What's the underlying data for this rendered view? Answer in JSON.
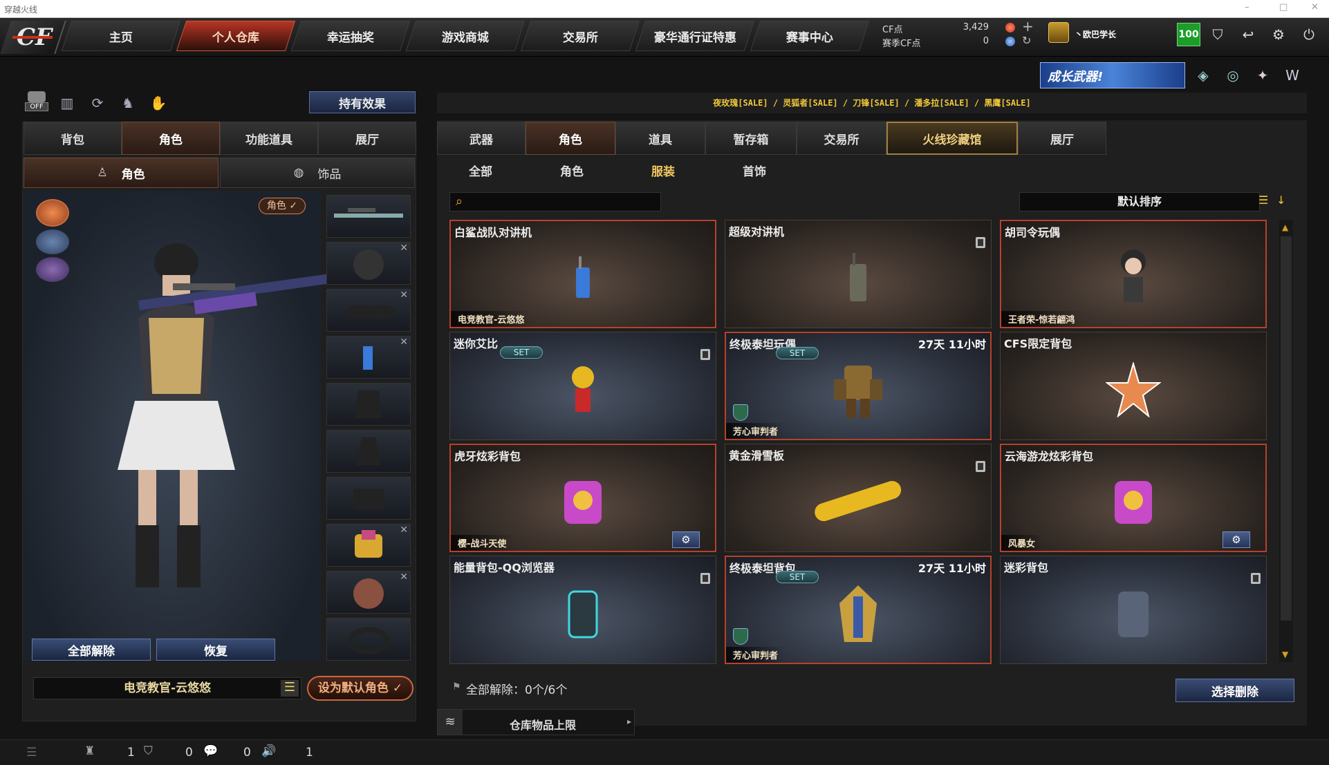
{
  "window": {
    "title": "穿越火线",
    "controls": [
      "–",
      "□",
      "✕"
    ]
  },
  "nav": {
    "items": [
      "主页",
      "个人仓库",
      "幸运抽奖",
      "游戏商城",
      "交易所",
      "豪华通行证特惠",
      "赛事中心"
    ],
    "active": 1
  },
  "currency": {
    "cf_label": "CF点",
    "cf_value": "3,429",
    "match_label": "赛季CF点",
    "match_value": "0"
  },
  "user": {
    "name": "丶欧巴学长",
    "level": "100"
  },
  "promo": {
    "banner": "成长武器!",
    "sales": "夜玫瑰[SALE] / 灵狐者[SALE] / 刀锋[SALE] / 潘多拉[SALE] / 黑鹰[SALE]"
  },
  "left": {
    "effects_btn": "持有效果",
    "tabs": [
      "背包",
      "角色",
      "功能道具",
      "展厅"
    ],
    "active_tab": 1,
    "subtabs": [
      "角色",
      "饰品"
    ],
    "role_badge": "角色 ✓",
    "unequip_all": "全部解除",
    "restore": "恢复",
    "character_name": "电竞教官-云悠悠",
    "set_default": "设为默认角色 ✓",
    "off_label": "OFF"
  },
  "right": {
    "tabs": [
      "武器",
      "角色",
      "道具",
      "暂存箱",
      "交易所",
      "火线珍藏馆",
      "展厅"
    ],
    "active_tab": 1,
    "subtabs": [
      "全部",
      "角色",
      "服装",
      "首饰"
    ],
    "active_subtab": 2,
    "search_placeholder": "",
    "sort_label": "默认排序",
    "footer_unequip": "全部解除：0个/6个",
    "select_delete": "选择删除",
    "storage_limit": "仓库物品上限"
  },
  "items": [
    {
      "name": "白鲨战队对讲机",
      "owner": "电竞教官-云悠悠",
      "time": "",
      "set": false,
      "border": "red",
      "bg": "brown",
      "trash": false,
      "gear": false,
      "shield": false,
      "icon": "walkie-talkie-icon"
    },
    {
      "name": "超级对讲机",
      "owner": "",
      "time": "",
      "set": false,
      "border": "",
      "bg": "brown",
      "trash": true,
      "gear": false,
      "shield": false,
      "icon": "radio-icon"
    },
    {
      "name": "胡司令玩偶",
      "owner": "王者荣-惊若翩鸿",
      "time": "",
      "set": false,
      "border": "red",
      "bg": "brown",
      "trash": false,
      "gear": false,
      "shield": false,
      "icon": "doll-icon"
    },
    {
      "name": "迷你艾比",
      "owner": "",
      "time": "",
      "set": true,
      "border": "",
      "bg": "blue",
      "trash": true,
      "gear": false,
      "shield": false,
      "icon": "mini-doll-icon"
    },
    {
      "name": "终极泰坦玩偶",
      "owner": "芳心审判者",
      "time": "27天 11小时",
      "set": true,
      "border": "red",
      "bg": "blue",
      "trash": false,
      "gear": false,
      "shield": true,
      "icon": "titan-doll-icon"
    },
    {
      "name": "CFS限定背包",
      "owner": "",
      "time": "",
      "set": false,
      "border": "",
      "bg": "brown",
      "trash": false,
      "gear": false,
      "shield": false,
      "icon": "star-badge-icon"
    },
    {
      "name": "虎牙炫彩背包",
      "owner": "樱-战斗天使",
      "time": "",
      "set": false,
      "border": "red",
      "bg": "brown",
      "trash": false,
      "gear": true,
      "shield": false,
      "icon": "backpack-icon"
    },
    {
      "name": "黄金滑雪板",
      "owner": "",
      "time": "",
      "set": false,
      "border": "",
      "bg": "brown",
      "trash": true,
      "gear": false,
      "shield": false,
      "icon": "snowboard-icon"
    },
    {
      "name": "云海游龙炫彩背包",
      "owner": "风暴女",
      "time": "",
      "set": false,
      "border": "red",
      "bg": "brown",
      "trash": false,
      "gear": true,
      "shield": false,
      "icon": "backpack-icon"
    },
    {
      "name": "能量背包-QQ浏览器",
      "owner": "",
      "time": "",
      "set": false,
      "border": "",
      "bg": "blue",
      "trash": true,
      "gear": false,
      "shield": false,
      "icon": "energy-pack-icon"
    },
    {
      "name": "终极泰坦背包",
      "owner": "芳心审判者",
      "time": "27天 11小时",
      "set": true,
      "border": "red",
      "bg": "blue",
      "trash": false,
      "gear": false,
      "shield": true,
      "icon": "titan-pack-icon"
    },
    {
      "name": "迷彩背包",
      "owner": "",
      "time": "",
      "set": false,
      "border": "",
      "bg": "blue",
      "trash": true,
      "gear": false,
      "shield": false,
      "icon": "camo-pack-icon"
    }
  ],
  "set_label": "SET",
  "status": {
    "v1": "1",
    "v2": "0",
    "v3": "0",
    "v4": "1"
  }
}
